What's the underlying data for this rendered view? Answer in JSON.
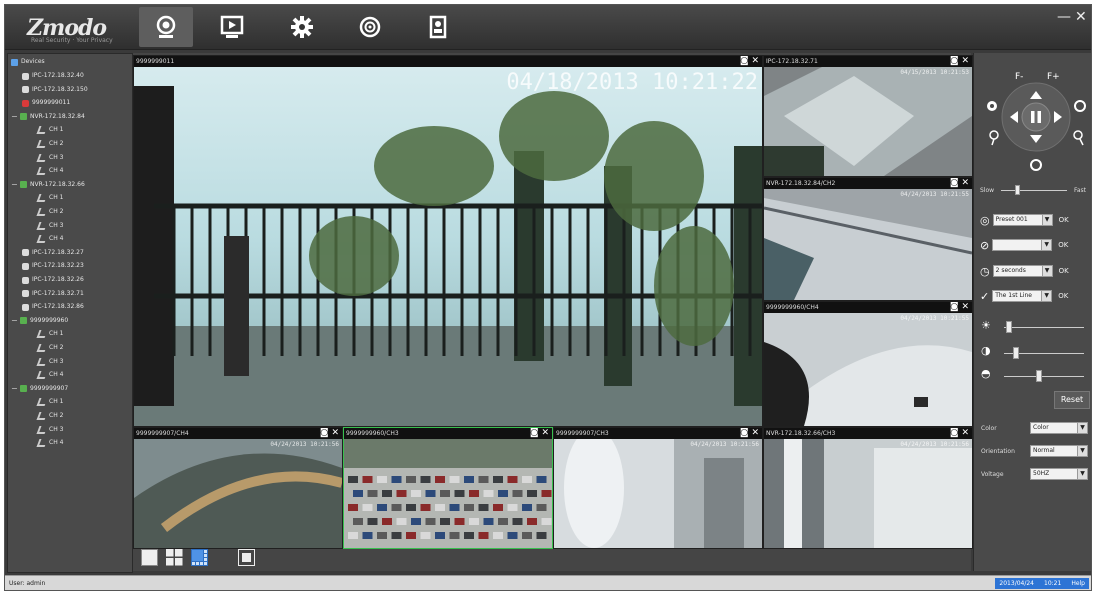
{
  "app": {
    "logo": "Zmodo",
    "tagline": "Real Security · Your Privacy"
  },
  "nav": [
    {
      "name": "live-view-tab",
      "icon": "camera-icon",
      "active": true
    },
    {
      "name": "playback-tab",
      "icon": "play-icon",
      "active": false
    },
    {
      "name": "settings-tab",
      "icon": "gear-icon",
      "active": false
    },
    {
      "name": "network-tab",
      "icon": "globe-icon",
      "active": false
    },
    {
      "name": "user-tab",
      "icon": "user-icon",
      "active": false
    }
  ],
  "window": {
    "minimize": "—",
    "close": "✕"
  },
  "tree": {
    "root": "Devices",
    "items": [
      {
        "type": "cam",
        "label": "IPC-172.18.32.40",
        "indent": 1
      },
      {
        "type": "cam",
        "label": "IPC-172.18.32.150",
        "indent": 1
      },
      {
        "type": "camred",
        "label": "9999999011",
        "indent": 1
      },
      {
        "type": "nvr",
        "label": "NVR-172.18.32.84",
        "indent": 0,
        "toggle": "−"
      },
      {
        "type": "ch",
        "label": "CH 1",
        "indent": 2
      },
      {
        "type": "ch",
        "label": "CH 2",
        "indent": 2
      },
      {
        "type": "ch",
        "label": "CH 3",
        "indent": 2
      },
      {
        "type": "ch",
        "label": "CH 4",
        "indent": 2
      },
      {
        "type": "nvr",
        "label": "NVR-172.18.32.66",
        "indent": 0,
        "toggle": "−"
      },
      {
        "type": "ch",
        "label": "CH 1",
        "indent": 2
      },
      {
        "type": "ch",
        "label": "CH 2",
        "indent": 2
      },
      {
        "type": "ch",
        "label": "CH 3",
        "indent": 2
      },
      {
        "type": "ch",
        "label": "CH 4",
        "indent": 2
      },
      {
        "type": "cam",
        "label": "IPC-172.18.32.27",
        "indent": 1
      },
      {
        "type": "cam",
        "label": "IPC-172.18.32.23",
        "indent": 1
      },
      {
        "type": "cam",
        "label": "IPC-172.18.32.26",
        "indent": 1
      },
      {
        "type": "cam",
        "label": "IPC-172.18.32.71",
        "indent": 1
      },
      {
        "type": "cam",
        "label": "IPC-172.18.32.86",
        "indent": 1
      },
      {
        "type": "nvr",
        "label": "9999999960",
        "indent": 0,
        "toggle": "−"
      },
      {
        "type": "ch",
        "label": "CH 1",
        "indent": 2
      },
      {
        "type": "ch",
        "label": "CH 2",
        "indent": 2
      },
      {
        "type": "ch",
        "label": "CH 3",
        "indent": 2
      },
      {
        "type": "ch",
        "label": "CH 4",
        "indent": 2
      },
      {
        "type": "nvr",
        "label": "9999999907",
        "indent": 0,
        "toggle": "−"
      },
      {
        "type": "ch",
        "label": "CH 1",
        "indent": 2
      },
      {
        "type": "ch",
        "label": "CH 2",
        "indent": 2
      },
      {
        "type": "ch",
        "label": "CH 3",
        "indent": 2
      },
      {
        "type": "ch",
        "label": "CH 4",
        "indent": 2
      }
    ]
  },
  "cells": {
    "main": {
      "title": "9999999011",
      "datetime": "04/18/2013  10:21:22"
    },
    "r1": {
      "title": "IPC-172.18.32.71",
      "datetime": "04/15/2013 10:21:53"
    },
    "r2": {
      "title": "NVR-172.18.32.84/CH2",
      "datetime": "04/24/2013 10:21:55"
    },
    "r3": {
      "title": "9999999960/CH4",
      "datetime": "04/24/2013 10:21:55"
    },
    "b1": {
      "title": "9999999907/CH4",
      "datetime": "04/24/2013 10:21:56"
    },
    "b2": {
      "title": "9999999960/CH3",
      "datetime": ""
    },
    "b3": {
      "title": "9999999907/CH3",
      "datetime": "04/24/2013 10:21:56"
    },
    "b4": {
      "title": "NVR-172.18.32.66/CH3",
      "datetime": "04/24/2013 10:21:56"
    }
  },
  "ptz": {
    "focus_near": "F-",
    "focus_far": "F+",
    "speed_slow": "Slow",
    "speed_fast": "Fast",
    "preset_value": "Preset 001",
    "cruise_value": "",
    "interval_value": "2 seconds",
    "line_value": "The 1st Line",
    "ok": "OK",
    "reset": "Reset",
    "brightness": 0.02,
    "contrast": 0.12,
    "saturation": 0.42
  },
  "settings": {
    "color_label": "Color",
    "color_value": "Color",
    "orientation_label": "Orientation",
    "orientation_value": "Normal",
    "voltage_label": "Voltage",
    "voltage_value": "50HZ"
  },
  "status": {
    "user": "User: admin",
    "right_items": [
      "2013/04/24",
      "10:21",
      "Help"
    ]
  }
}
